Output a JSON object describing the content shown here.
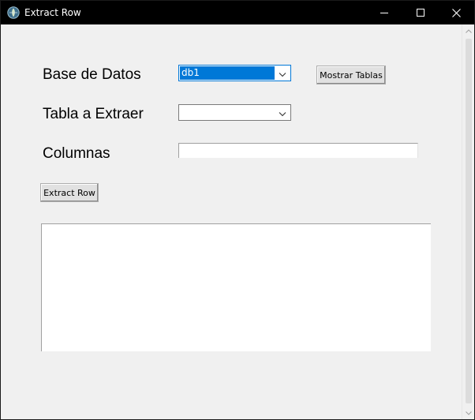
{
  "window": {
    "title": "Extract Row"
  },
  "form": {
    "database": {
      "label": "Base de Datos",
      "selected": "db1"
    },
    "show_tables_button": "Mostrar Tablas",
    "table": {
      "label": "Tabla a Extraer",
      "selected": ""
    },
    "columns": {
      "label": "Columnas",
      "value": ""
    },
    "extract_button": "Extract Row",
    "output": ""
  },
  "colors": {
    "titlebar": "#000000",
    "window_bg": "#f0f0f0",
    "selection": "#0078d7",
    "button_bg": "#e1e1e1"
  },
  "icons": {
    "app": "feather-globe-icon",
    "minimize": "minimize-icon",
    "maximize": "maximize-icon",
    "close": "close-icon",
    "dropdown": "chevron-down-icon"
  }
}
